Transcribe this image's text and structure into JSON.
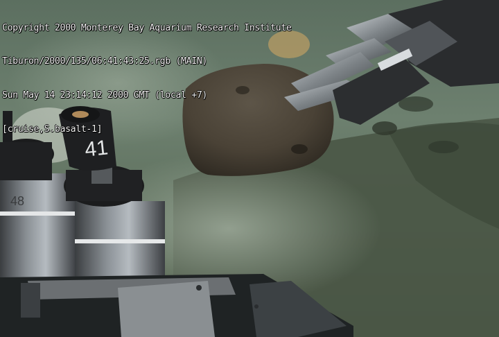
{
  "video_overlay": {
    "line1": "Copyright 2000 Monterey Bay Aquarium Research Institute",
    "line2": "Tiburon/2000/135/06:41:43:25.rgb (MAIN)",
    "line3": "Sun May 14 23:14:12 2000 GMT (local +7)",
    "line4": "[cruise,S.basalt-1]"
  },
  "sampler": {
    "tube_label": "41",
    "tube_label_left": "48"
  },
  "colors": {
    "water": "#6f8272",
    "sediment": "#4d5a48",
    "rock": "#4a4338",
    "metal": "#8e9498",
    "overlay_text": "#f2f2f2"
  }
}
